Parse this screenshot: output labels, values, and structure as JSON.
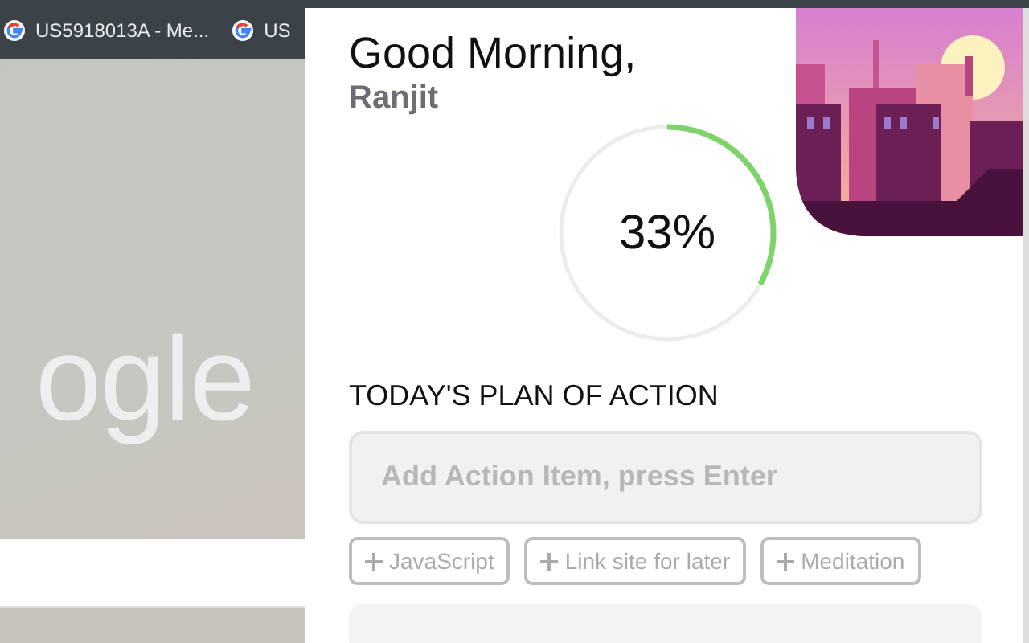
{
  "browser_tabs": [
    {
      "title": "US5918013A - Me..."
    },
    {
      "title": "US"
    }
  ],
  "background_page": {
    "logo_text": "ogle"
  },
  "panel": {
    "greeting": "Good Morning,",
    "user_name": "Ranjit",
    "progress": {
      "level": 0.33,
      "reading": "33%"
    },
    "section_title": "TODAY'S PLAN OF ACTION",
    "input": {
      "placeholder": "Add Action Item, press Enter"
    },
    "suggestions": [
      {
        "label": "JavaScript"
      },
      {
        "label": "Link site for later"
      },
      {
        "label": "Meditation"
      }
    ]
  }
}
